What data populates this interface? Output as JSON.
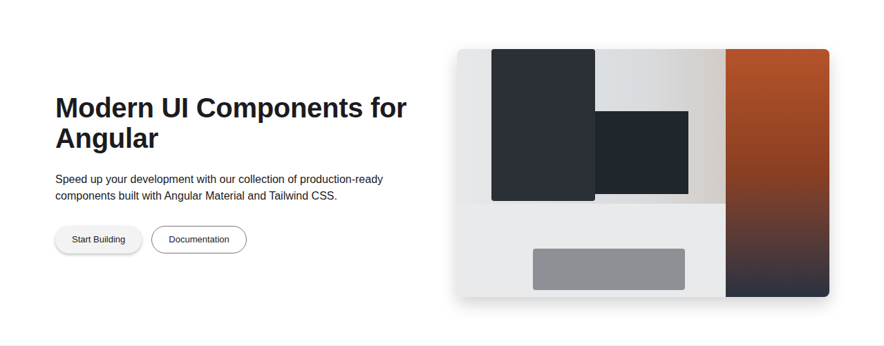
{
  "hero": {
    "title": "Modern UI Components for Angular",
    "description": "Speed up your development with our collection of production-ready components built with Angular Material and Tailwind CSS.",
    "buttons": [
      {
        "label": "Start Building",
        "kind": "filled"
      },
      {
        "label": "Documentation",
        "kind": "outlined"
      }
    ]
  }
}
